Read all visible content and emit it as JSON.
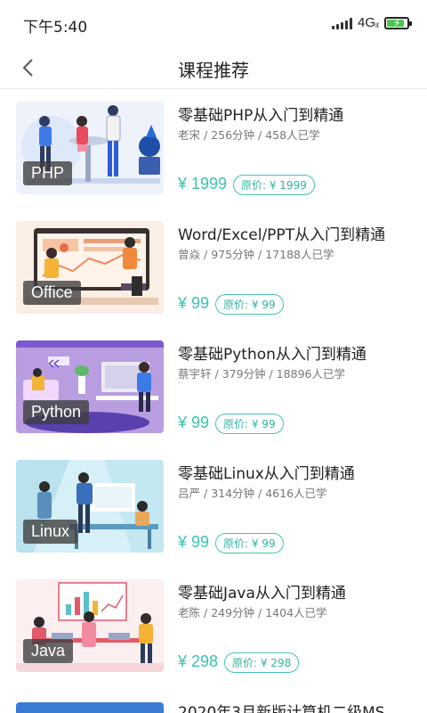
{
  "status": {
    "time": "下午5:40",
    "network": "4G",
    "network_sub": "it",
    "battery_level": 0.85
  },
  "nav": {
    "title": "课程推荐",
    "back_icon": "chevron-left-icon"
  },
  "colors": {
    "accent": "#3cc2b2",
    "battery": "#4cc552"
  },
  "courses": [
    {
      "tag": "PHP",
      "title": "零基础PHP从入门到精通",
      "author": "老宋",
      "duration": "256分钟",
      "learners": "458人已学",
      "price": "¥ 1999",
      "original": "原价: ¥ 1999"
    },
    {
      "tag": "Office",
      "title": "Word/Excel/PPT从入门到精通",
      "author": "曾焱",
      "duration": "975分钟",
      "learners": "17188人已学",
      "price": "¥ 99",
      "original": "原价: ¥ 99"
    },
    {
      "tag": "Python",
      "title": "零基础Python从入门到精通",
      "author": "蔡宇轩",
      "duration": "379分钟",
      "learners": "18896人已学",
      "price": "¥ 99",
      "original": "原价: ¥ 99"
    },
    {
      "tag": "Linux",
      "title": "零基础Linux从入门到精通",
      "author": "吕严",
      "duration": "314分钟",
      "learners": "4616人已学",
      "price": "¥ 99",
      "original": "原价: ¥ 99"
    },
    {
      "tag": "Java",
      "title": "零基础Java从入门到精通",
      "author": "老陈",
      "duration": "249分钟",
      "learners": "1404人已学",
      "price": "¥ 298",
      "original": "原价: ¥ 298"
    }
  ],
  "partial_course": {
    "title": "2020年3月新版计算机二级MS"
  }
}
